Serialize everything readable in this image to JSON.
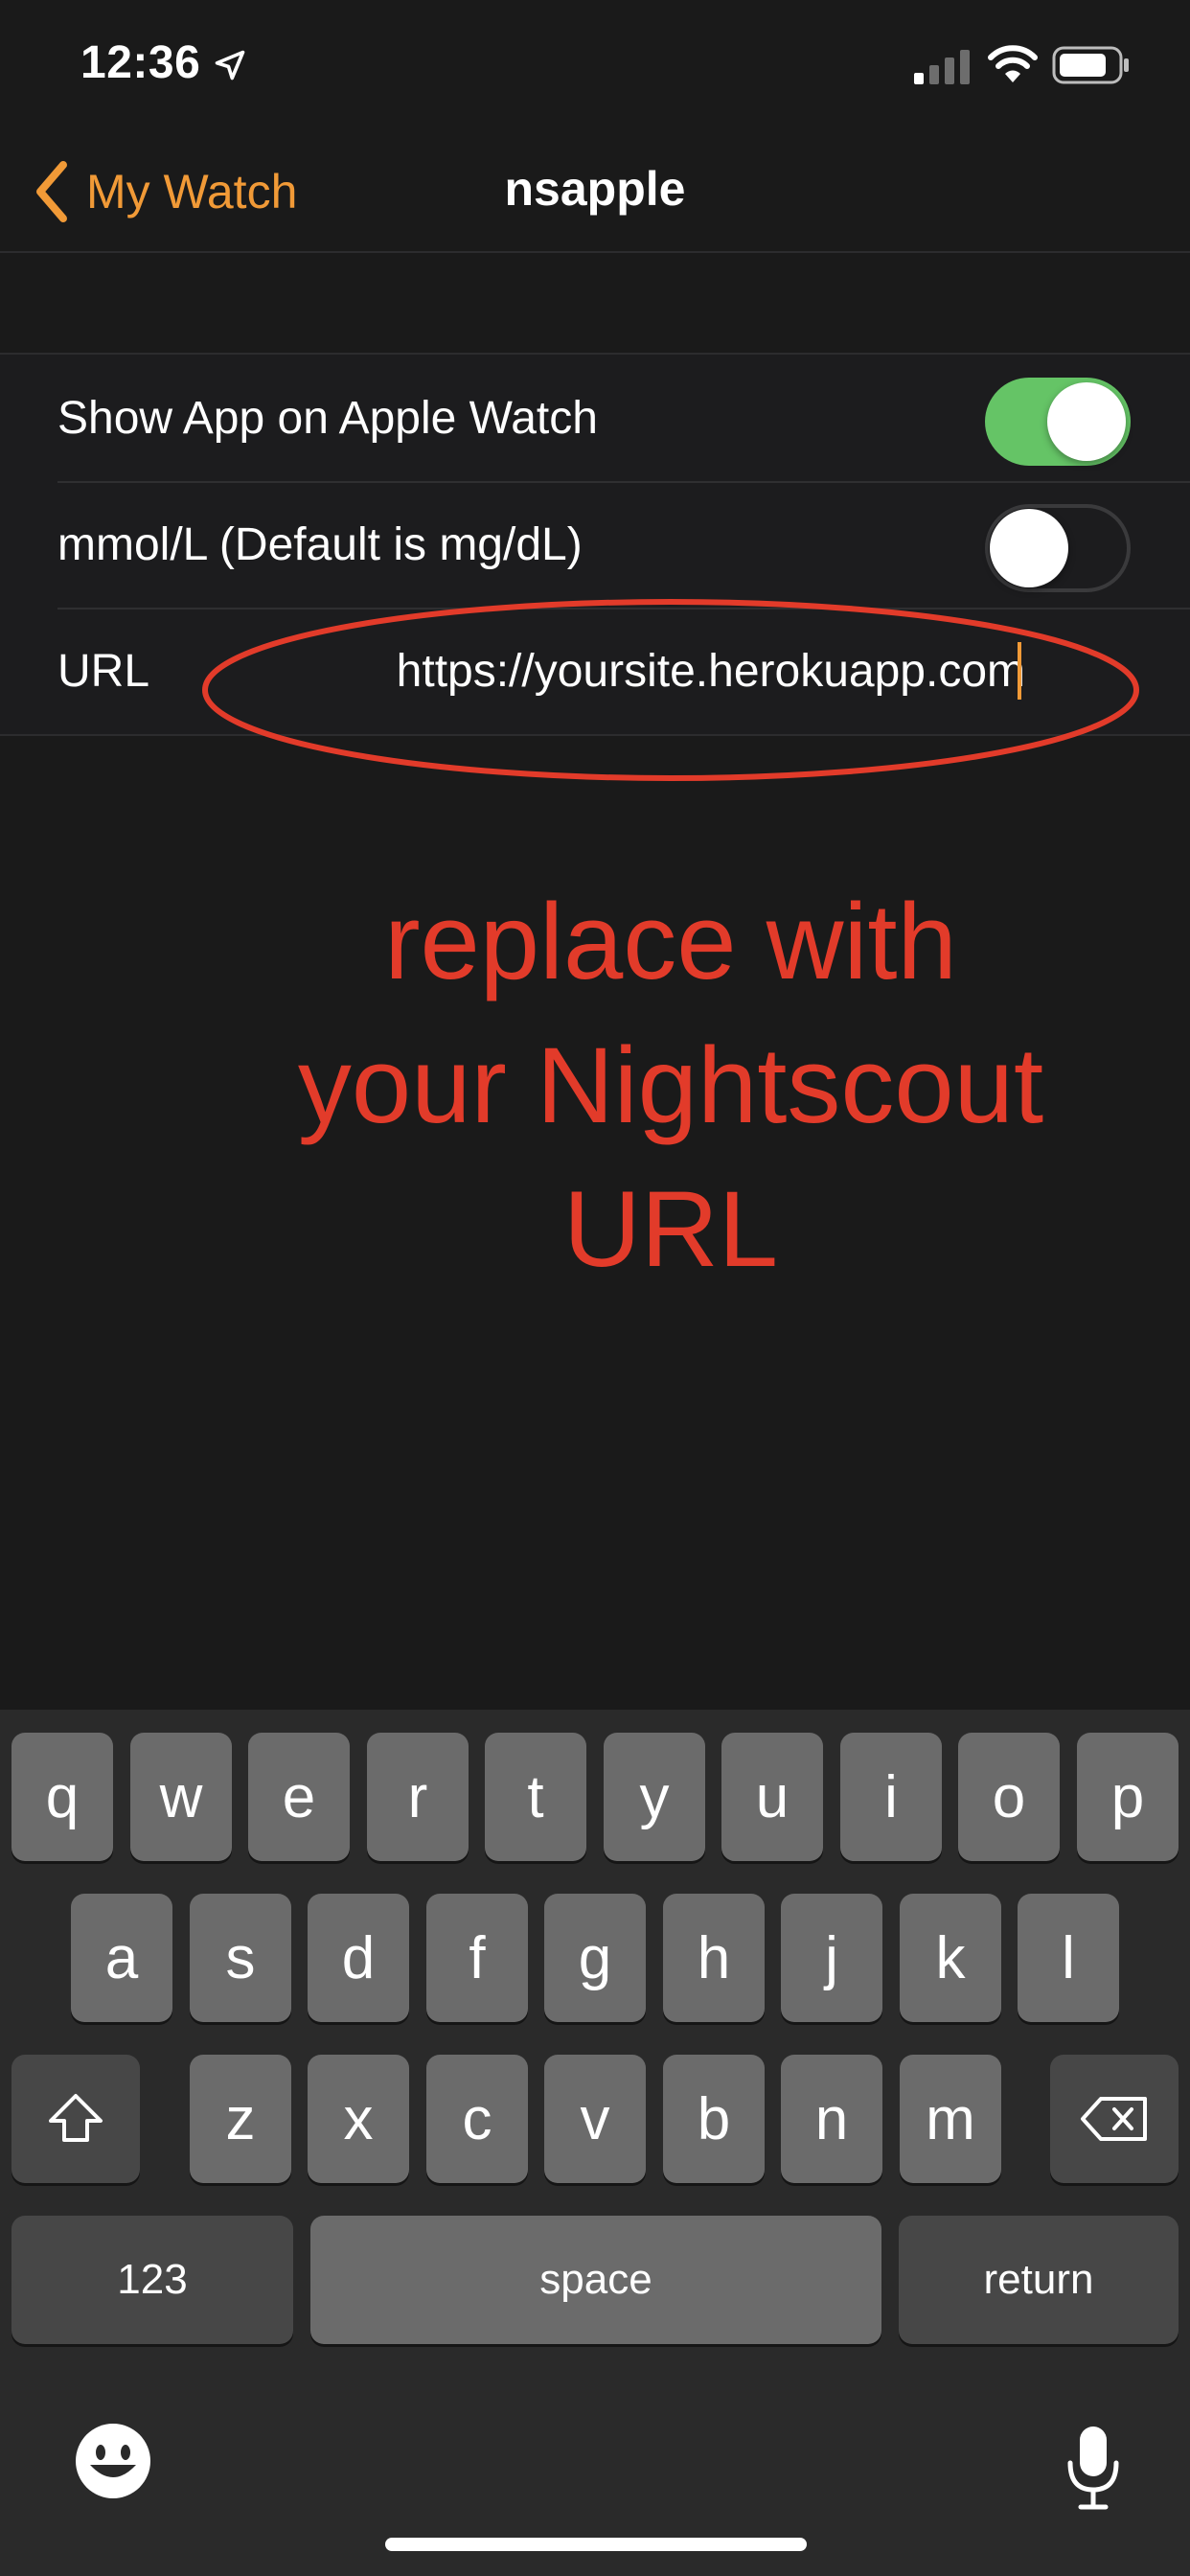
{
  "status_bar": {
    "time": "12:36"
  },
  "nav": {
    "back_label": "My Watch",
    "title": "nsapple"
  },
  "settings": {
    "show_app_label": "Show App on Apple Watch",
    "show_app_on": true,
    "mmol_label": "mmol/L (Default is mg/dL)",
    "mmol_on": false,
    "url_label": "URL",
    "url_value": "https://yoursite.herokuapp.com"
  },
  "annotation": {
    "line1": "replace with",
    "line2": "your Nightscout",
    "line3": "URL",
    "color": "#e23b2a"
  },
  "keyboard": {
    "row1": [
      "q",
      "w",
      "e",
      "r",
      "t",
      "y",
      "u",
      "i",
      "o",
      "p"
    ],
    "row2": [
      "a",
      "s",
      "d",
      "f",
      "g",
      "h",
      "j",
      "k",
      "l"
    ],
    "row3": [
      "z",
      "x",
      "c",
      "v",
      "b",
      "n",
      "m"
    ],
    "numbers_label": "123",
    "space_label": "space",
    "return_label": "return"
  },
  "colors": {
    "accent": "#f19a37",
    "toggle_on": "#65c466",
    "background": "#1a1a1a"
  }
}
